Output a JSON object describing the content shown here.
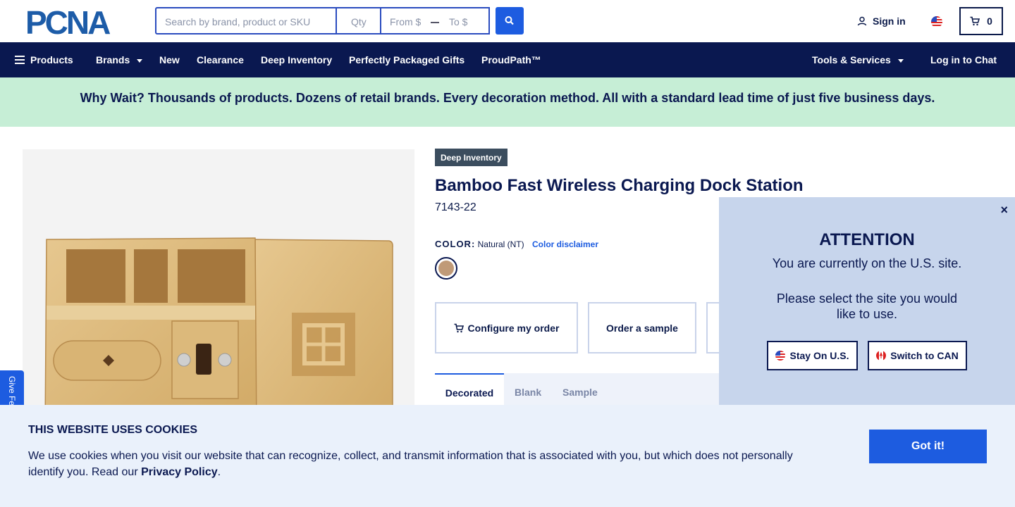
{
  "header": {
    "logo_text": "PCNA",
    "search_placeholder": "Search by brand, product or SKU",
    "qty_placeholder": "Qty",
    "price_from": "From $",
    "price_to": "To $",
    "signin_label": "Sign in",
    "cart_count": "0"
  },
  "nav": {
    "products": "Products",
    "brands": "Brands",
    "new": "New",
    "clearance": "Clearance",
    "deep_inventory": "Deep Inventory",
    "gifts": "Perfectly Packaged Gifts",
    "proudpath": "ProudPath™",
    "tools": "Tools & Services",
    "chat": "Log in to Chat"
  },
  "promo": {
    "text": "Why Wait? Thousands of products. Dozens of retail brands. Every decoration method. All with a standard lead time of just five business days."
  },
  "feedback": {
    "label": "Give Feedback"
  },
  "product": {
    "badge": "Deep Inventory",
    "title": "Bamboo Fast Wireless Charging Dock Station",
    "sku": "7143-22",
    "color_label": "COLOR:",
    "color_value": "Natural (NT)",
    "color_disclaimer": "Color disclaimer",
    "swatch_color": "#c09a77",
    "configure_label": "Configure my order",
    "sample_label": "Order a sample",
    "tabs": [
      "Decorated",
      "Blank",
      "Sample"
    ]
  },
  "modal": {
    "close": "×",
    "title": "ATTENTION",
    "message1": "You are currently on the U.S. site.",
    "message2": "Please select the site you would like to use.",
    "stay_label": "Stay On U.S.",
    "switch_label": "Switch to CAN"
  },
  "cookie": {
    "title": "THIS WEBSITE USES COOKIES",
    "body": "We use cookies when you visit our website that can recognize, collect, and transmit information that is associated with you, but which does not personally identify you. Read our ",
    "policy_link": "Privacy Policy",
    "period": ".",
    "button": "Got it!"
  },
  "colors": {
    "navy": "#0a1850",
    "accent": "#1d5ce0",
    "promo_bg": "#c6eed6",
    "modal_bg": "#c7d5ec",
    "cookie_bg": "#eaf1fb"
  }
}
